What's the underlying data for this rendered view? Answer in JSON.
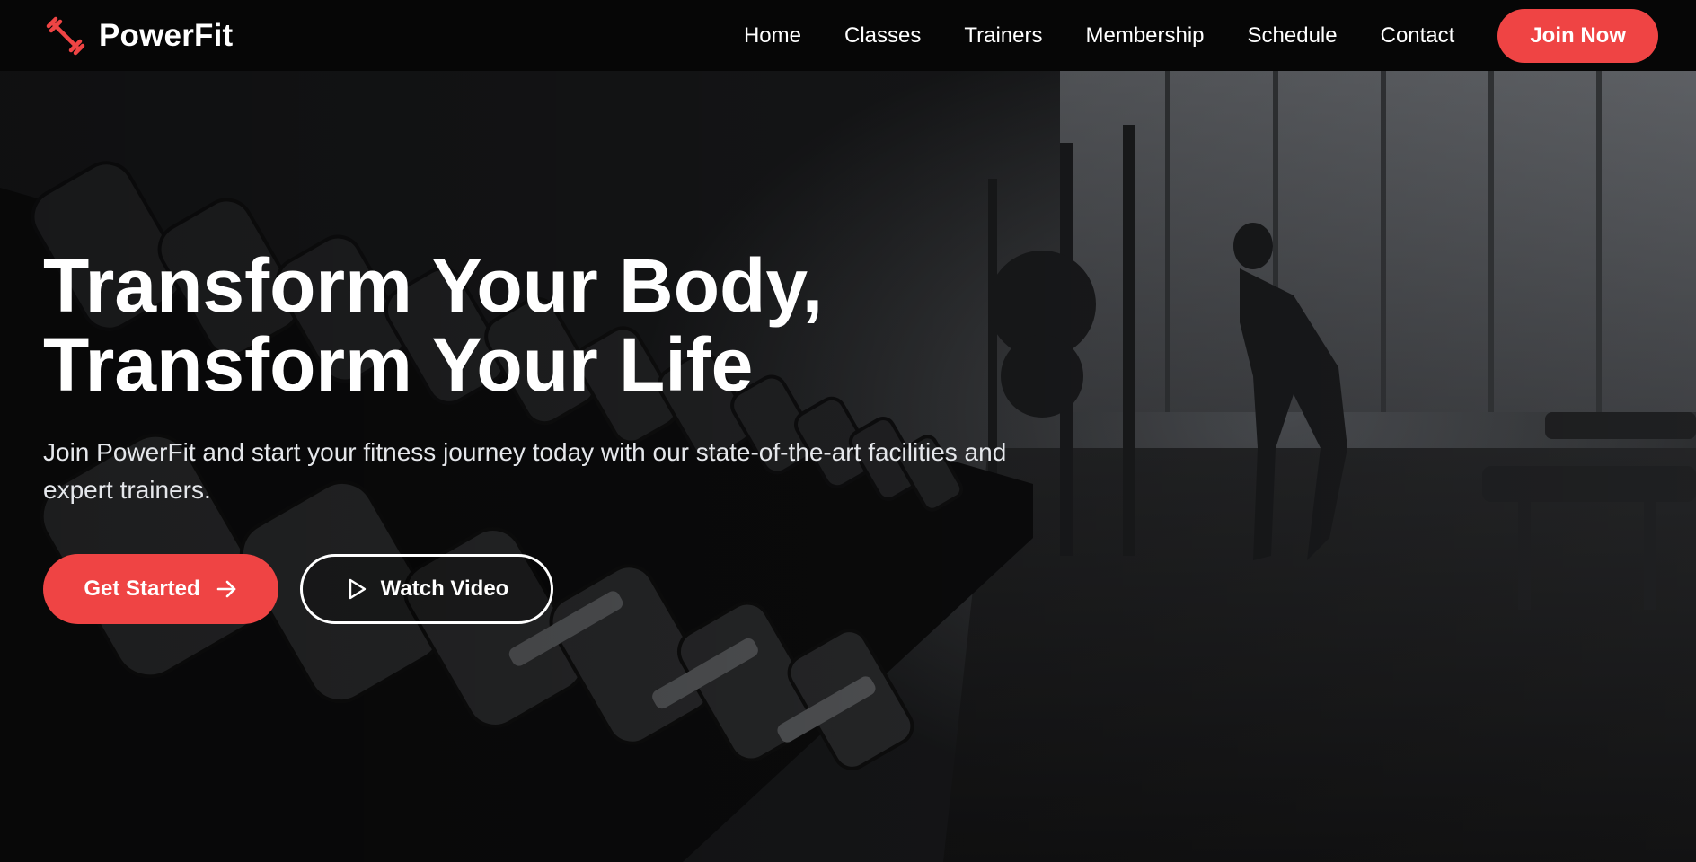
{
  "brand": {
    "name": "PowerFit",
    "logo_icon": "dumbbell-icon",
    "accent_color": "#ef4444"
  },
  "nav": {
    "links": [
      {
        "label": "Home"
      },
      {
        "label": "Classes"
      },
      {
        "label": "Trainers"
      },
      {
        "label": "Membership"
      },
      {
        "label": "Schedule"
      },
      {
        "label": "Contact"
      }
    ],
    "cta_label": "Join Now"
  },
  "hero": {
    "title_line1": "Transform Your Body,",
    "title_line2": "Transform Your Life",
    "subtitle": "Join PowerFit and start your fitness journey today with our state-of-the-art facilities and expert trainers.",
    "primary_button": {
      "label": "Get Started",
      "icon": "arrow-right-icon"
    },
    "secondary_button": {
      "label": "Watch Video",
      "icon": "play-icon"
    },
    "background": "gym-dumbbell-rack-photo"
  }
}
